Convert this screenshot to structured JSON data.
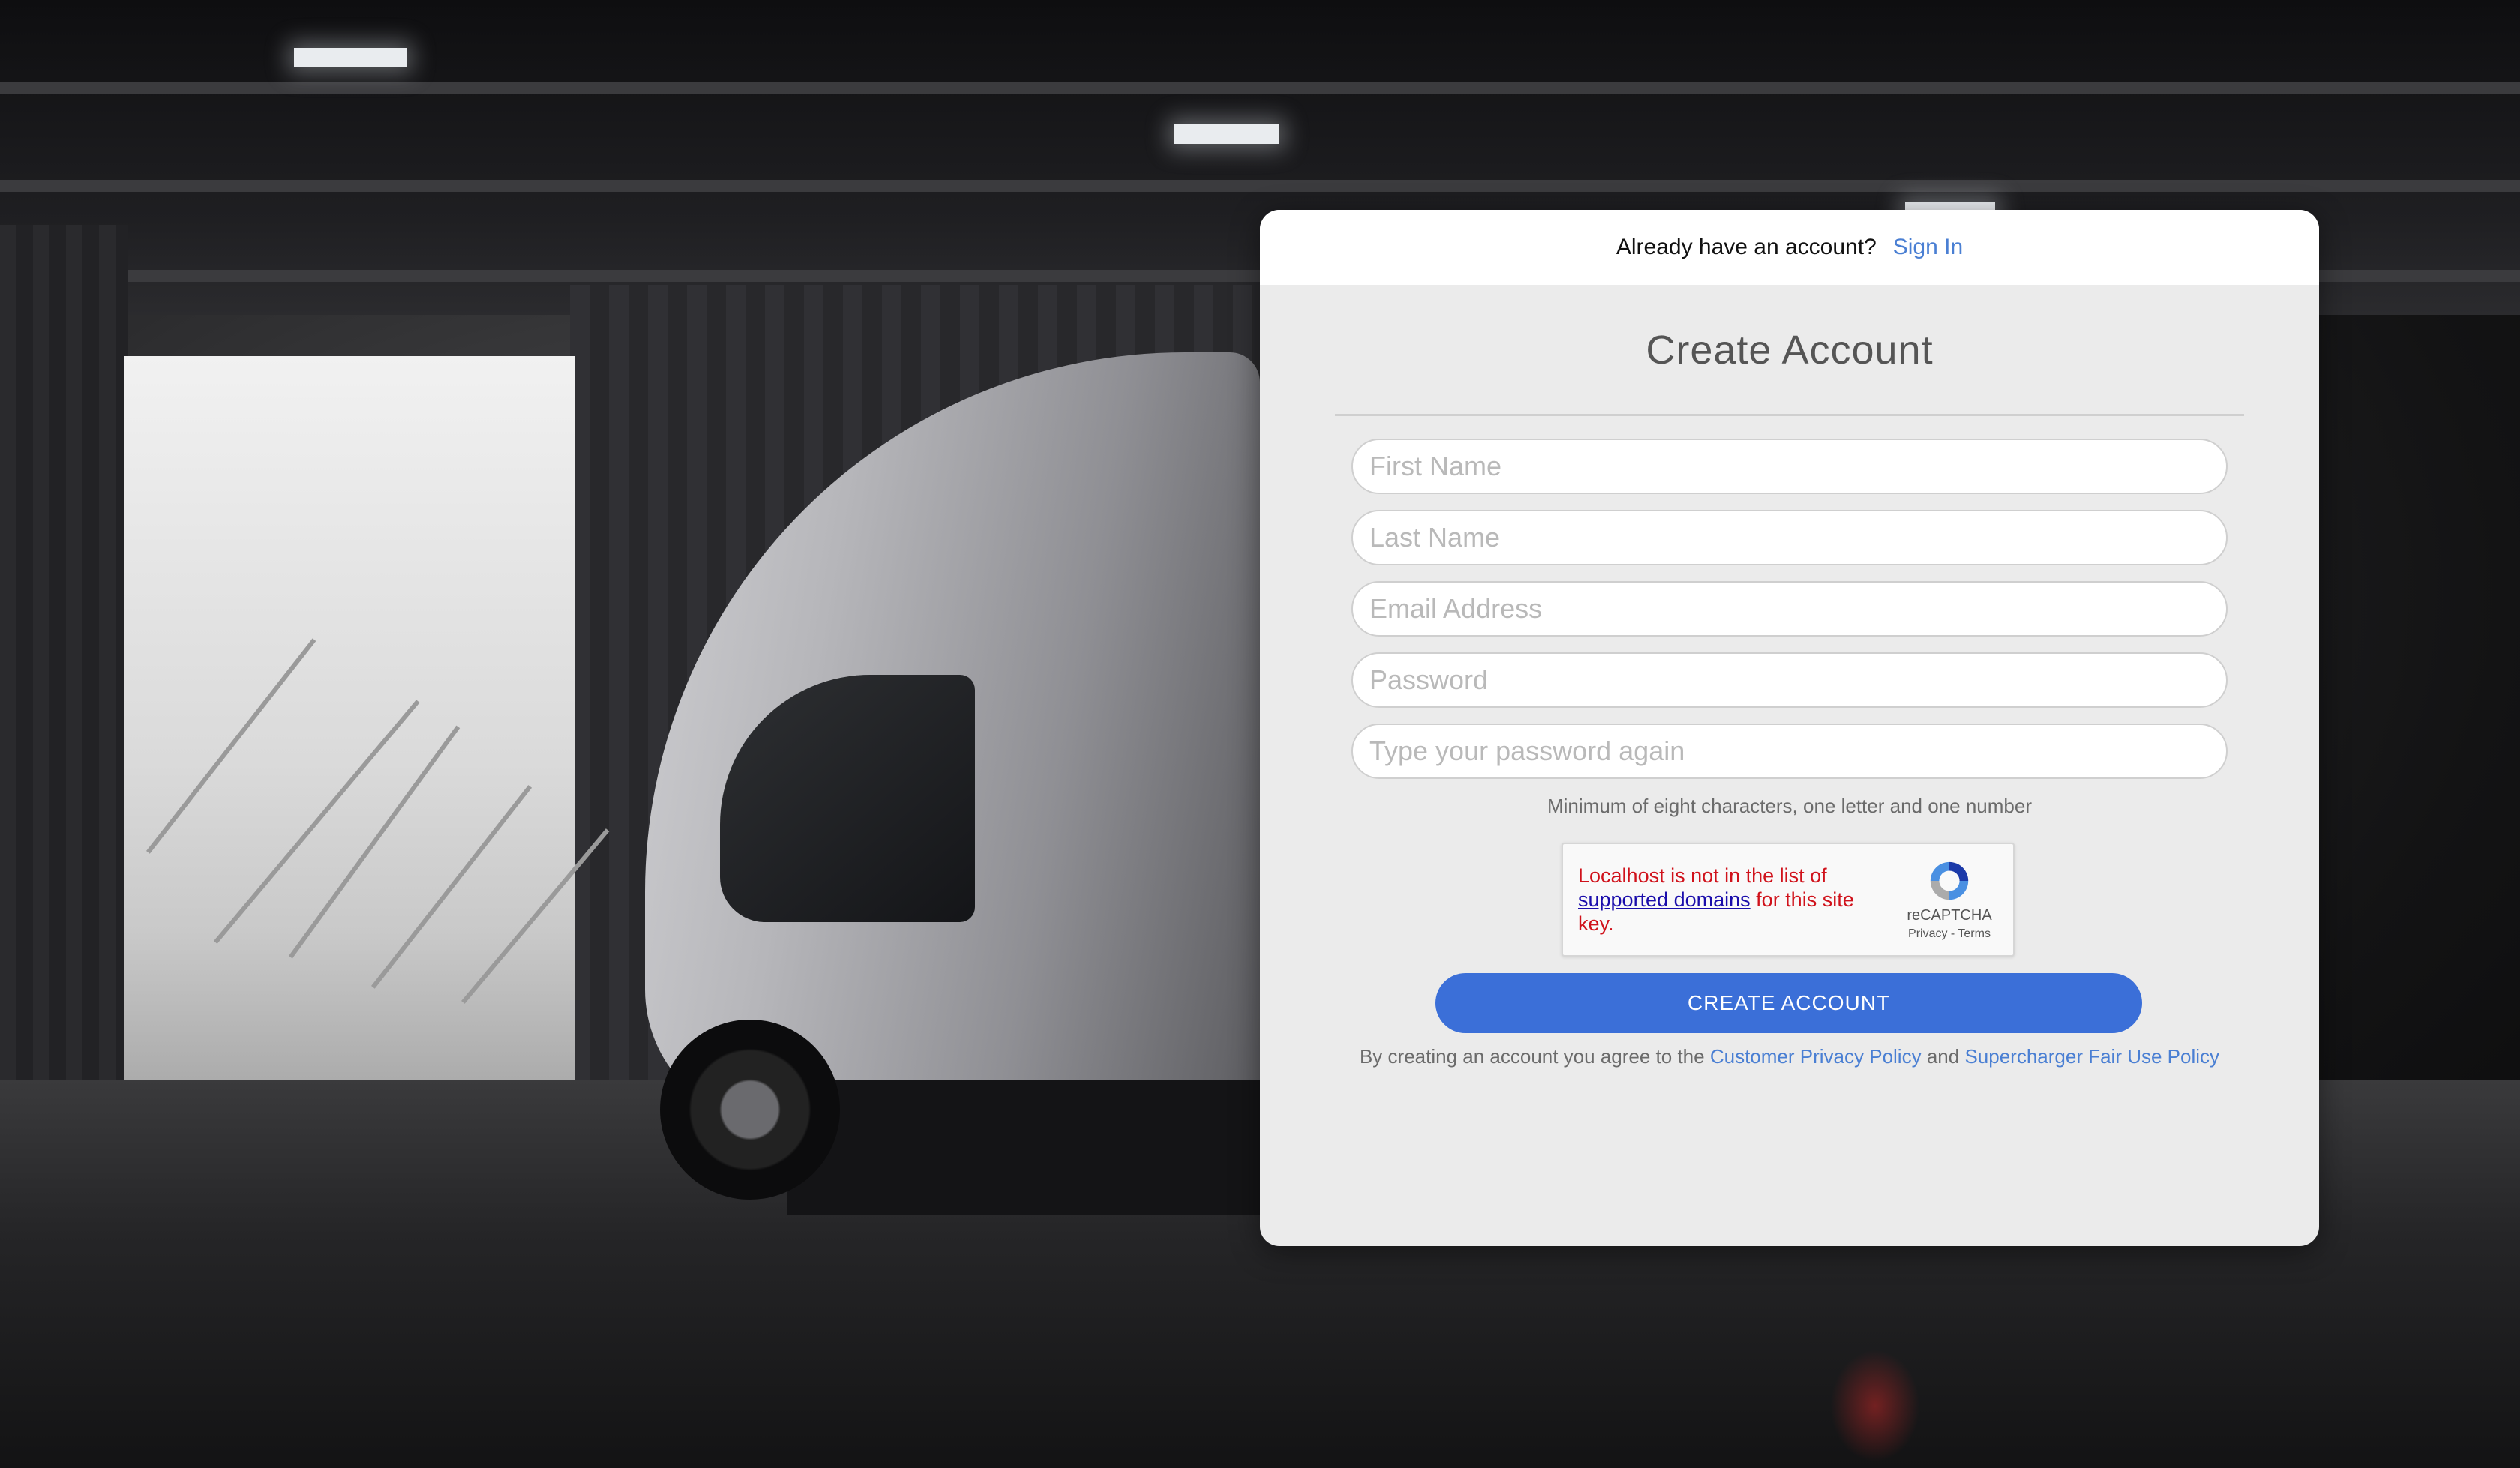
{
  "header": {
    "prompt": "Already have an account?",
    "signin_label": "Sign In"
  },
  "form": {
    "title": "Create Account",
    "fields": {
      "first_name": {
        "placeholder": "First Name",
        "value": ""
      },
      "last_name": {
        "placeholder": "Last Name",
        "value": ""
      },
      "email": {
        "placeholder": "Email Address",
        "value": ""
      },
      "password": {
        "placeholder": "Password",
        "value": ""
      },
      "password_confirm": {
        "placeholder": "Type your password again",
        "value": ""
      }
    },
    "password_hint": "Minimum of eight characters, one letter and one number",
    "submit_label": "CREATE ACCOUNT"
  },
  "captcha": {
    "error_prefix": "Localhost is not in the list of",
    "error_link": "supported domains",
    "error_suffix": "for this site key.",
    "brand": "reCAPTCHA",
    "privacy": "Privacy",
    "separator": "-",
    "terms": "Terms"
  },
  "legal": {
    "prefix": "By creating an account you agree to the",
    "privacy_link": "Customer Privacy Policy",
    "conjunction": "and",
    "fair_use_link": "Supercharger Fair Use Policy"
  },
  "colors": {
    "accent": "#3b6fd8",
    "link": "#4a7fd3",
    "error": "#d0121b"
  },
  "icons": {
    "captcha": "recaptcha-icon"
  }
}
